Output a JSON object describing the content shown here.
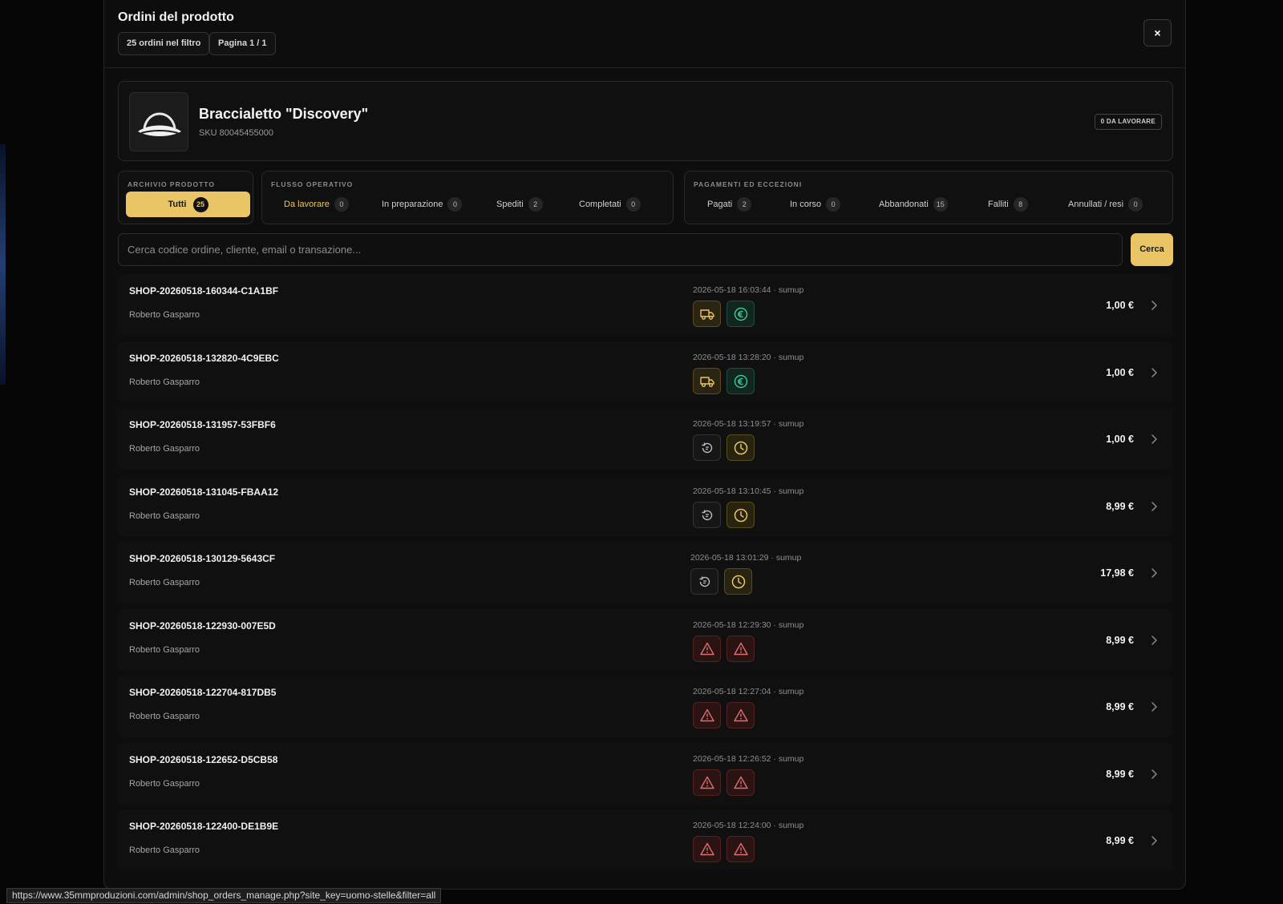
{
  "modal": {
    "title": "Ordini del prodotto",
    "filter_count_chip": "25 ordini nel filtro",
    "page_chip": "Pagina 1 / 1",
    "close_label": "×"
  },
  "product": {
    "name": "Braccialetto \"Discovery\"",
    "sku": "SKU 80045455000",
    "todo_badge": "0 DA LAVORARE"
  },
  "filters": {
    "archive": {
      "title": "ARCHIVIO PRODOTTO",
      "all_label": "Tutti",
      "all_count": "25"
    },
    "workflow": {
      "title": "FLUSSO OPERATIVO",
      "tabs": [
        {
          "label": "Da lavorare",
          "count": "0"
        },
        {
          "label": "In preparazione",
          "count": "0"
        },
        {
          "label": "Spediti",
          "count": "2"
        },
        {
          "label": "Completati",
          "count": "0"
        }
      ]
    },
    "payments": {
      "title": "PAGAMENTI ED ECCEZIONI",
      "tabs": [
        {
          "label": "Pagati",
          "count": "2"
        },
        {
          "label": "In corso",
          "count": "0"
        },
        {
          "label": "Abbandonati",
          "count": "15"
        },
        {
          "label": "Falliti",
          "count": "8"
        },
        {
          "label": "Annullati / resi",
          "count": "0"
        }
      ]
    }
  },
  "search": {
    "placeholder": "Cerca codice ordine, cliente, email o transazione...",
    "button_label": "Cerca"
  },
  "orders": [
    {
      "code": "SHOP-20260518-160344-C1A1BF",
      "customer": "Roberto Gasparro",
      "meta": "2026-05-18 16:03:44 · sumup",
      "amount": "1,00 €",
      "icons": [
        "truck-icon",
        "euro-icon"
      ]
    },
    {
      "code": "SHOP-20260518-132820-4C9EBC",
      "customer": "Roberto Gasparro",
      "meta": "2026-05-18 13:28:20 · sumup",
      "amount": "1,00 €",
      "icons": [
        "truck-icon",
        "euro-icon"
      ]
    },
    {
      "code": "SHOP-20260518-131957-53FBF6",
      "customer": "Roberto Gasparro",
      "meta": "2026-05-18 13:19:57 · sumup",
      "amount": "1,00 €",
      "icons": [
        "reset-icon",
        "clock-icon"
      ]
    },
    {
      "code": "SHOP-20260518-131045-FBAA12",
      "customer": "Roberto Gasparro",
      "meta": "2026-05-18 13:10:45 · sumup",
      "amount": "8,99 €",
      "icons": [
        "reset-icon",
        "clock-icon"
      ]
    },
    {
      "code": "SHOP-20260518-130129-5643CF",
      "customer": "Roberto Gasparro",
      "meta": "2026-05-18 13:01:29 · sumup",
      "amount": "17,98 €",
      "icons": [
        "reset-icon",
        "clock-icon"
      ]
    },
    {
      "code": "SHOP-20260518-122930-007E5D",
      "customer": "Roberto Gasparro",
      "meta": "2026-05-18 12:29:30 · sumup",
      "amount": "8,99 €",
      "icons": [
        "warning-icon",
        "warning-icon"
      ]
    },
    {
      "code": "SHOP-20260518-122704-817DB5",
      "customer": "Roberto Gasparro",
      "meta": "2026-05-18 12:27:04 · sumup",
      "amount": "8,99 €",
      "icons": [
        "warning-icon",
        "warning-icon"
      ]
    },
    {
      "code": "SHOP-20260518-122652-D5CB58",
      "customer": "Roberto Gasparro",
      "meta": "2026-05-18 12:26:52 · sumup",
      "amount": "8,99 €",
      "icons": [
        "warning-icon",
        "warning-icon"
      ]
    },
    {
      "code": "SHOP-20260518-122400-DE1B9E",
      "customer": "Roberto Gasparro",
      "meta": "2026-05-18 12:24:00 · sumup",
      "amount": "8,99 €",
      "icons": [
        "warning-icon",
        "warning-icon"
      ]
    }
  ],
  "status_bar": {
    "url": "https://www.35mmproduzioni.com/admin/shop_orders_manage.php?site_key=uomo-stelle&filter=all"
  },
  "colors": {
    "accent": "#e9c565",
    "background": "#0d0d0d",
    "truck": "#e9c565",
    "euro": "#3fc79a",
    "warning": "#e06c6c"
  }
}
